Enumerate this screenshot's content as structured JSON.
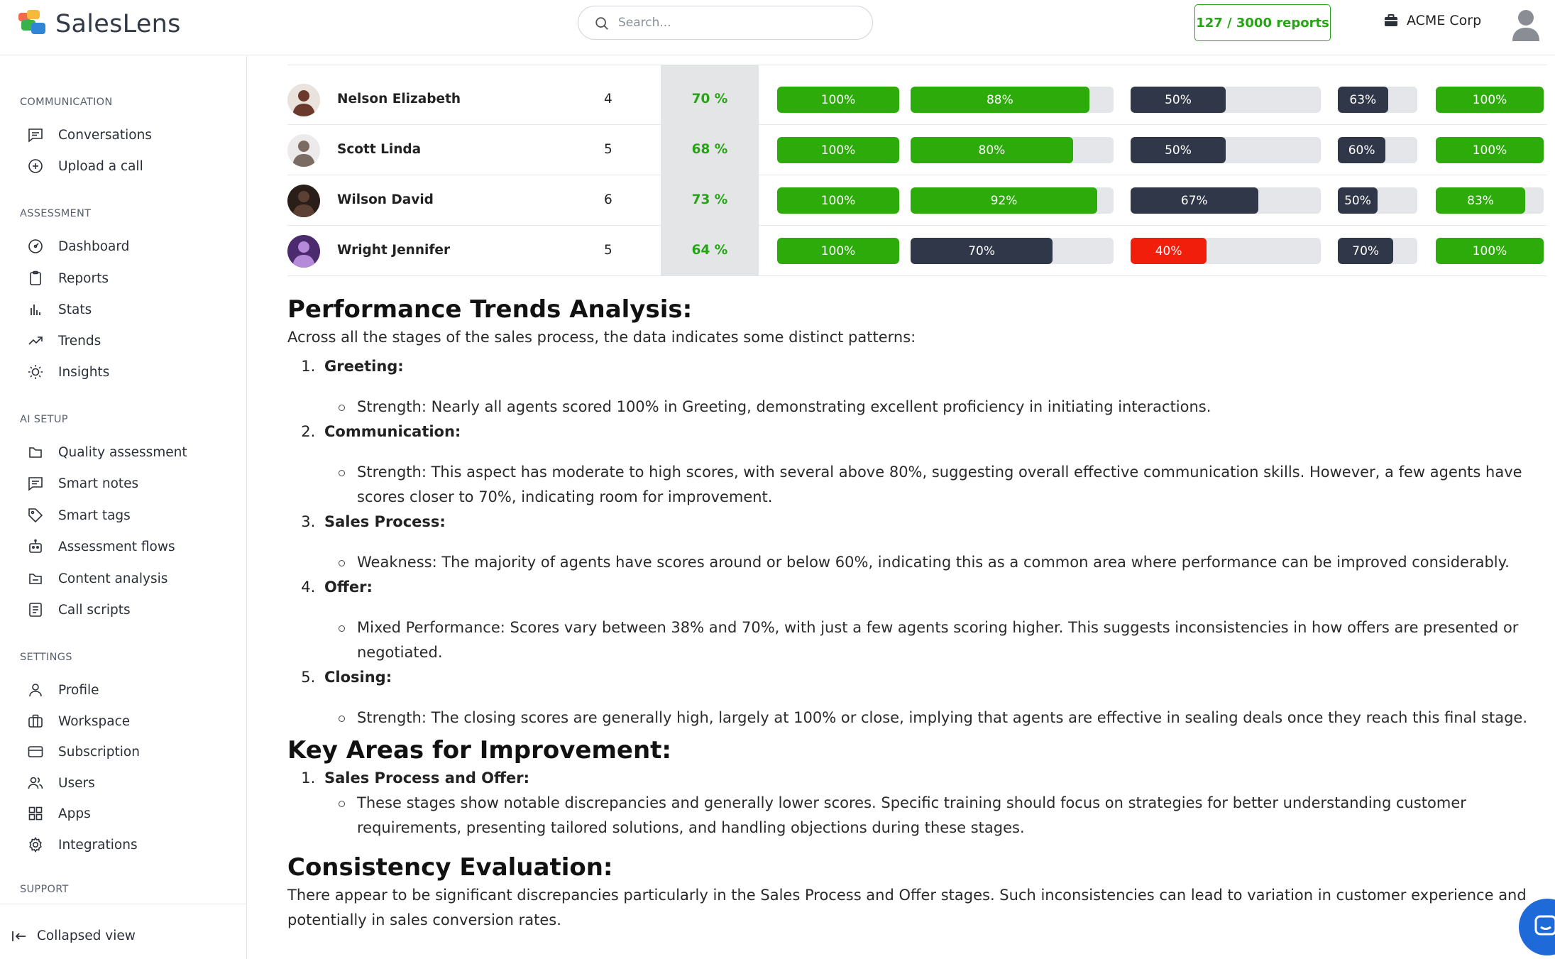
{
  "app": {
    "name": "SalesLens"
  },
  "header": {
    "search_placeholder": "Search...",
    "reports_usage": "127 / 3000 reports",
    "workspace_name": "ACME Corp"
  },
  "sidebar": {
    "sections": {
      "communication": "COMMUNICATION",
      "assessment": "ASSESSMENT",
      "ai_setup": "AI SETUP",
      "settings": "SETTINGS",
      "support": "SUPPORT"
    },
    "items": {
      "conversations": "Conversations",
      "upload_call": "Upload a call",
      "dashboard": "Dashboard",
      "reports": "Reports",
      "stats": "Stats",
      "trends": "Trends",
      "insights": "Insights",
      "quality_assessment": "Quality assessment",
      "smart_notes": "Smart notes",
      "smart_tags": "Smart tags",
      "assessment_flows": "Assessment flows",
      "content_analysis": "Content analysis",
      "call_scripts": "Call scripts",
      "profile": "Profile",
      "workspace": "Workspace",
      "subscription": "Subscription",
      "users": "Users",
      "apps": "Apps",
      "integrations": "Integrations"
    },
    "collapse_label": "Collapsed view"
  },
  "table": {
    "rows": [
      {
        "name": "Nelson Elizabeth",
        "count": "4",
        "score": "70 %",
        "stages": [
          {
            "value": 100,
            "label": "100%",
            "color": "green"
          },
          {
            "value": 88,
            "label": "88%",
            "color": "green"
          },
          {
            "value": 50,
            "label": "50%",
            "color": "dark"
          },
          {
            "value": 63,
            "label": "63%",
            "color": "dark"
          },
          {
            "value": 100,
            "label": "100%",
            "color": "green"
          }
        ]
      },
      {
        "name": "Scott Linda",
        "count": "5",
        "score": "68 %",
        "stages": [
          {
            "value": 100,
            "label": "100%",
            "color": "green"
          },
          {
            "value": 80,
            "label": "80%",
            "color": "green"
          },
          {
            "value": 50,
            "label": "50%",
            "color": "dark"
          },
          {
            "value": 60,
            "label": "60%",
            "color": "dark"
          },
          {
            "value": 100,
            "label": "100%",
            "color": "green"
          }
        ]
      },
      {
        "name": "Wilson David",
        "count": "6",
        "score": "73 %",
        "stages": [
          {
            "value": 100,
            "label": "100%",
            "color": "green"
          },
          {
            "value": 92,
            "label": "92%",
            "color": "green"
          },
          {
            "value": 67,
            "label": "67%",
            "color": "dark"
          },
          {
            "value": 50,
            "label": "50%",
            "color": "dark"
          },
          {
            "value": 83,
            "label": "83%",
            "color": "green"
          }
        ]
      },
      {
        "name": "Wright Jennifer",
        "count": "5",
        "score": "64 %",
        "stages": [
          {
            "value": 100,
            "label": "100%",
            "color": "green"
          },
          {
            "value": 70,
            "label": "70%",
            "color": "dark"
          },
          {
            "value": 40,
            "label": "40%",
            "color": "red"
          },
          {
            "value": 70,
            "label": "70%",
            "color": "dark"
          },
          {
            "value": 100,
            "label": "100%",
            "color": "green"
          }
        ]
      }
    ]
  },
  "report": {
    "trends_title": "Performance Trends Analysis:",
    "trends_intro": "Across all the stages of the sales process, the data indicates some distinct patterns:",
    "stages": [
      {
        "title": "Greeting:",
        "point": "Strength: Nearly all agents scored 100% in Greeting, demonstrating excellent proficiency in initiating interactions."
      },
      {
        "title": "Communication:",
        "point": "Strength: This aspect has moderate to high scores, with several above 80%, suggesting overall effective communication skills. However, a few agents have scores closer to 70%, indicating room for improvement."
      },
      {
        "title": "Sales Process:",
        "point": "Weakness: The majority of agents have scores around or below 60%, indicating this as a common area where performance can be improved considerably."
      },
      {
        "title": "Offer:",
        "point": "Mixed Performance: Scores vary between 38% and 70%, with just a few agents scoring higher. This suggests inconsistencies in how offers are presented or negotiated."
      },
      {
        "title": "Closing:",
        "point": "Strength: The closing scores are generally high, largely at 100% or close, implying that agents are effective in sealing deals once they reach this final stage."
      }
    ],
    "improvement_title": "Key Areas for Improvement:",
    "improvement_item_title": "Sales Process and Offer:",
    "improvement_item_point": "These stages show notable discrepancies and generally lower scores. Specific training should focus on strategies for better understanding customer requirements, presenting tailored solutions, and handling objections during these stages.",
    "consistency_title": "Consistency Evaluation:",
    "consistency_text": "There appear to be significant discrepancies particularly in the Sales Process and Offer stages. Such inconsistencies can lead to variation in customer experience and potentially in sales conversion rates."
  },
  "colors": {
    "green": "#2cab0a",
    "dark": "#303748",
    "red": "#f21e0c",
    "accent_green": "#26a514"
  }
}
